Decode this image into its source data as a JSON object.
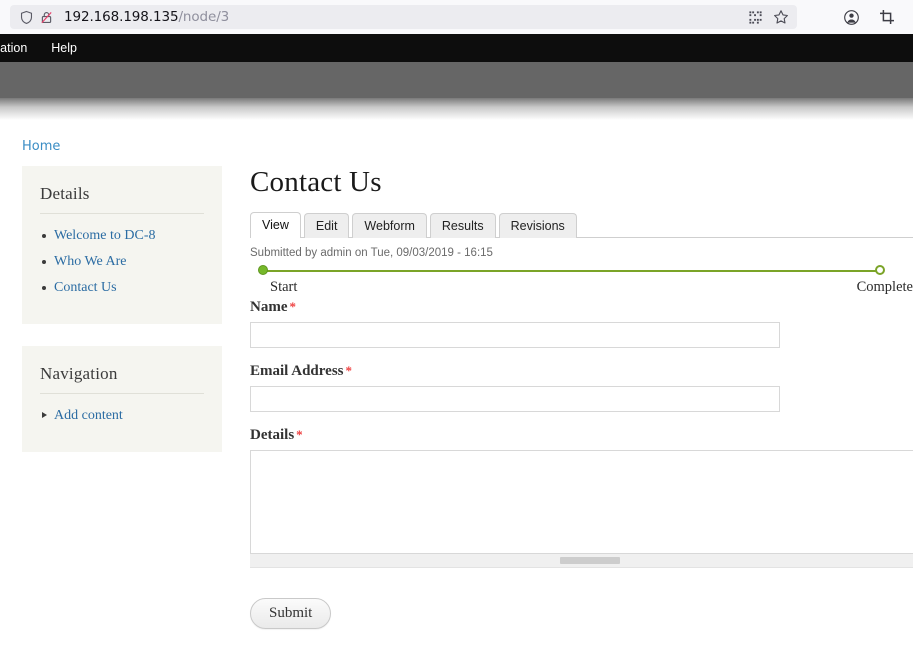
{
  "browser": {
    "url_host": "192.168.198.135",
    "url_path": "/node/3",
    "icons": {
      "shield": "shield-icon",
      "lock_broken": "broken-lock-icon",
      "qr": "qr-code-icon",
      "star": "bookmark-star-icon",
      "account": "account-circle-icon",
      "screenshot": "screenshot-crop-icon"
    }
  },
  "admin_toolbar": {
    "items": [
      {
        "label": "ration"
      },
      {
        "label": "Help"
      }
    ]
  },
  "breadcrumb": {
    "home_label": "Home"
  },
  "sidebar": {
    "blocks": [
      {
        "title": "Details",
        "items": [
          {
            "label": "Welcome to DC-8",
            "marker": "bullet"
          },
          {
            "label": "Who We Are",
            "marker": "bullet"
          },
          {
            "label": "Contact Us",
            "marker": "bullet"
          }
        ]
      },
      {
        "title": "Navigation",
        "items": [
          {
            "label": "Add content",
            "marker": "arrow"
          }
        ]
      }
    ]
  },
  "main": {
    "title": "Contact Us",
    "tabs": [
      {
        "label": "View",
        "active": true
      },
      {
        "label": "Edit",
        "active": false
      },
      {
        "label": "Webform",
        "active": false
      },
      {
        "label": "Results",
        "active": false
      },
      {
        "label": "Revisions",
        "active": false
      }
    ],
    "submitted_text": "Submitted by admin on Tue, 09/03/2019 - 16:15",
    "progress": {
      "start_label": "Start",
      "end_label": "Complete",
      "line_color": "#7ba428",
      "start_dot_color": "#76b82a"
    },
    "form": {
      "fields": [
        {
          "label": "Name",
          "required_mark": "*",
          "value": "",
          "placeholder": ""
        },
        {
          "label": "Email Address",
          "required_mark": "*",
          "value": "",
          "placeholder": ""
        },
        {
          "label": "Details",
          "required_mark": "*",
          "value": "",
          "placeholder": ""
        }
      ],
      "submit_label": "Submit"
    }
  },
  "colors": {
    "link_blue": "#2b6ca3",
    "breadcrumb_blue": "#3a8dc4",
    "required_red": "#ee3d3d",
    "sidebar_bg": "#f5f5f0",
    "header_band": "#666666",
    "toolbar_bg": "#0d0d0d"
  }
}
